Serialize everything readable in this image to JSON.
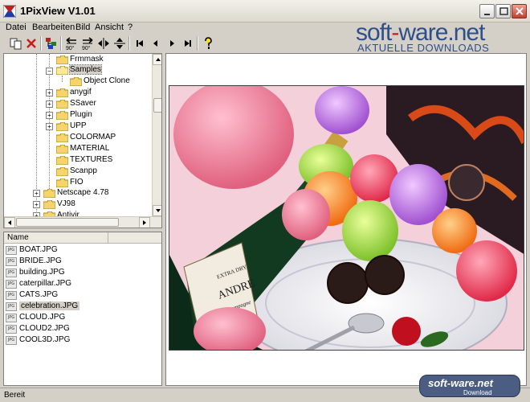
{
  "window": {
    "title": "1PixView V1.01"
  },
  "watermark": {
    "brand_a": "soft",
    "brand_dash": "-",
    "brand_b": "ware.net",
    "subtitle": "AKTUELLE DOWNLOADS"
  },
  "menu": [
    {
      "label": "Datei"
    },
    {
      "label": "Bearbeiten"
    },
    {
      "label": "Bild"
    },
    {
      "label": "Ansicht"
    },
    {
      "label": "?"
    }
  ],
  "toolbar": {
    "rotate_left_label": "90°",
    "rotate_right_label": "90°"
  },
  "tree": {
    "items": [
      {
        "label": "Frmmask"
      },
      {
        "label": "Samples"
      },
      {
        "label": "Object Clone"
      },
      {
        "label": "anygif"
      },
      {
        "label": "SSaver"
      },
      {
        "label": "Plugin"
      },
      {
        "label": "UPP"
      },
      {
        "label": "COLORMAP"
      },
      {
        "label": "MATERIAL"
      },
      {
        "label": "TEXTURES"
      },
      {
        "label": "Scanpp"
      },
      {
        "label": "FIO"
      },
      {
        "label": "Netscape 4.78"
      },
      {
        "label": "VJ98"
      },
      {
        "label": "Antivir"
      }
    ]
  },
  "file_list": {
    "column_name": "Name",
    "icon_label": "JPG",
    "files": [
      {
        "name": "BOAT.JPG"
      },
      {
        "name": "BRIDE.JPG"
      },
      {
        "name": "building.JPG"
      },
      {
        "name": "caterpillar.JPG"
      },
      {
        "name": "CATS.JPG"
      },
      {
        "name": "celebration.JPG"
      },
      {
        "name": "CLOUD.JPG"
      },
      {
        "name": "CLOUD2.JPG"
      },
      {
        "name": "COOL3D.JPG"
      }
    ]
  },
  "photo": {
    "label_top": "EXTRA DRY",
    "label_brand": "ANDRE",
    "label_sub": "Champagne"
  },
  "status": {
    "text": "Bereit"
  },
  "badge": {
    "title": "soft-ware.net",
    "sub": "Download"
  },
  "colors": {
    "accent": "#2e4f8a",
    "watermark_red": "#c8202a"
  }
}
